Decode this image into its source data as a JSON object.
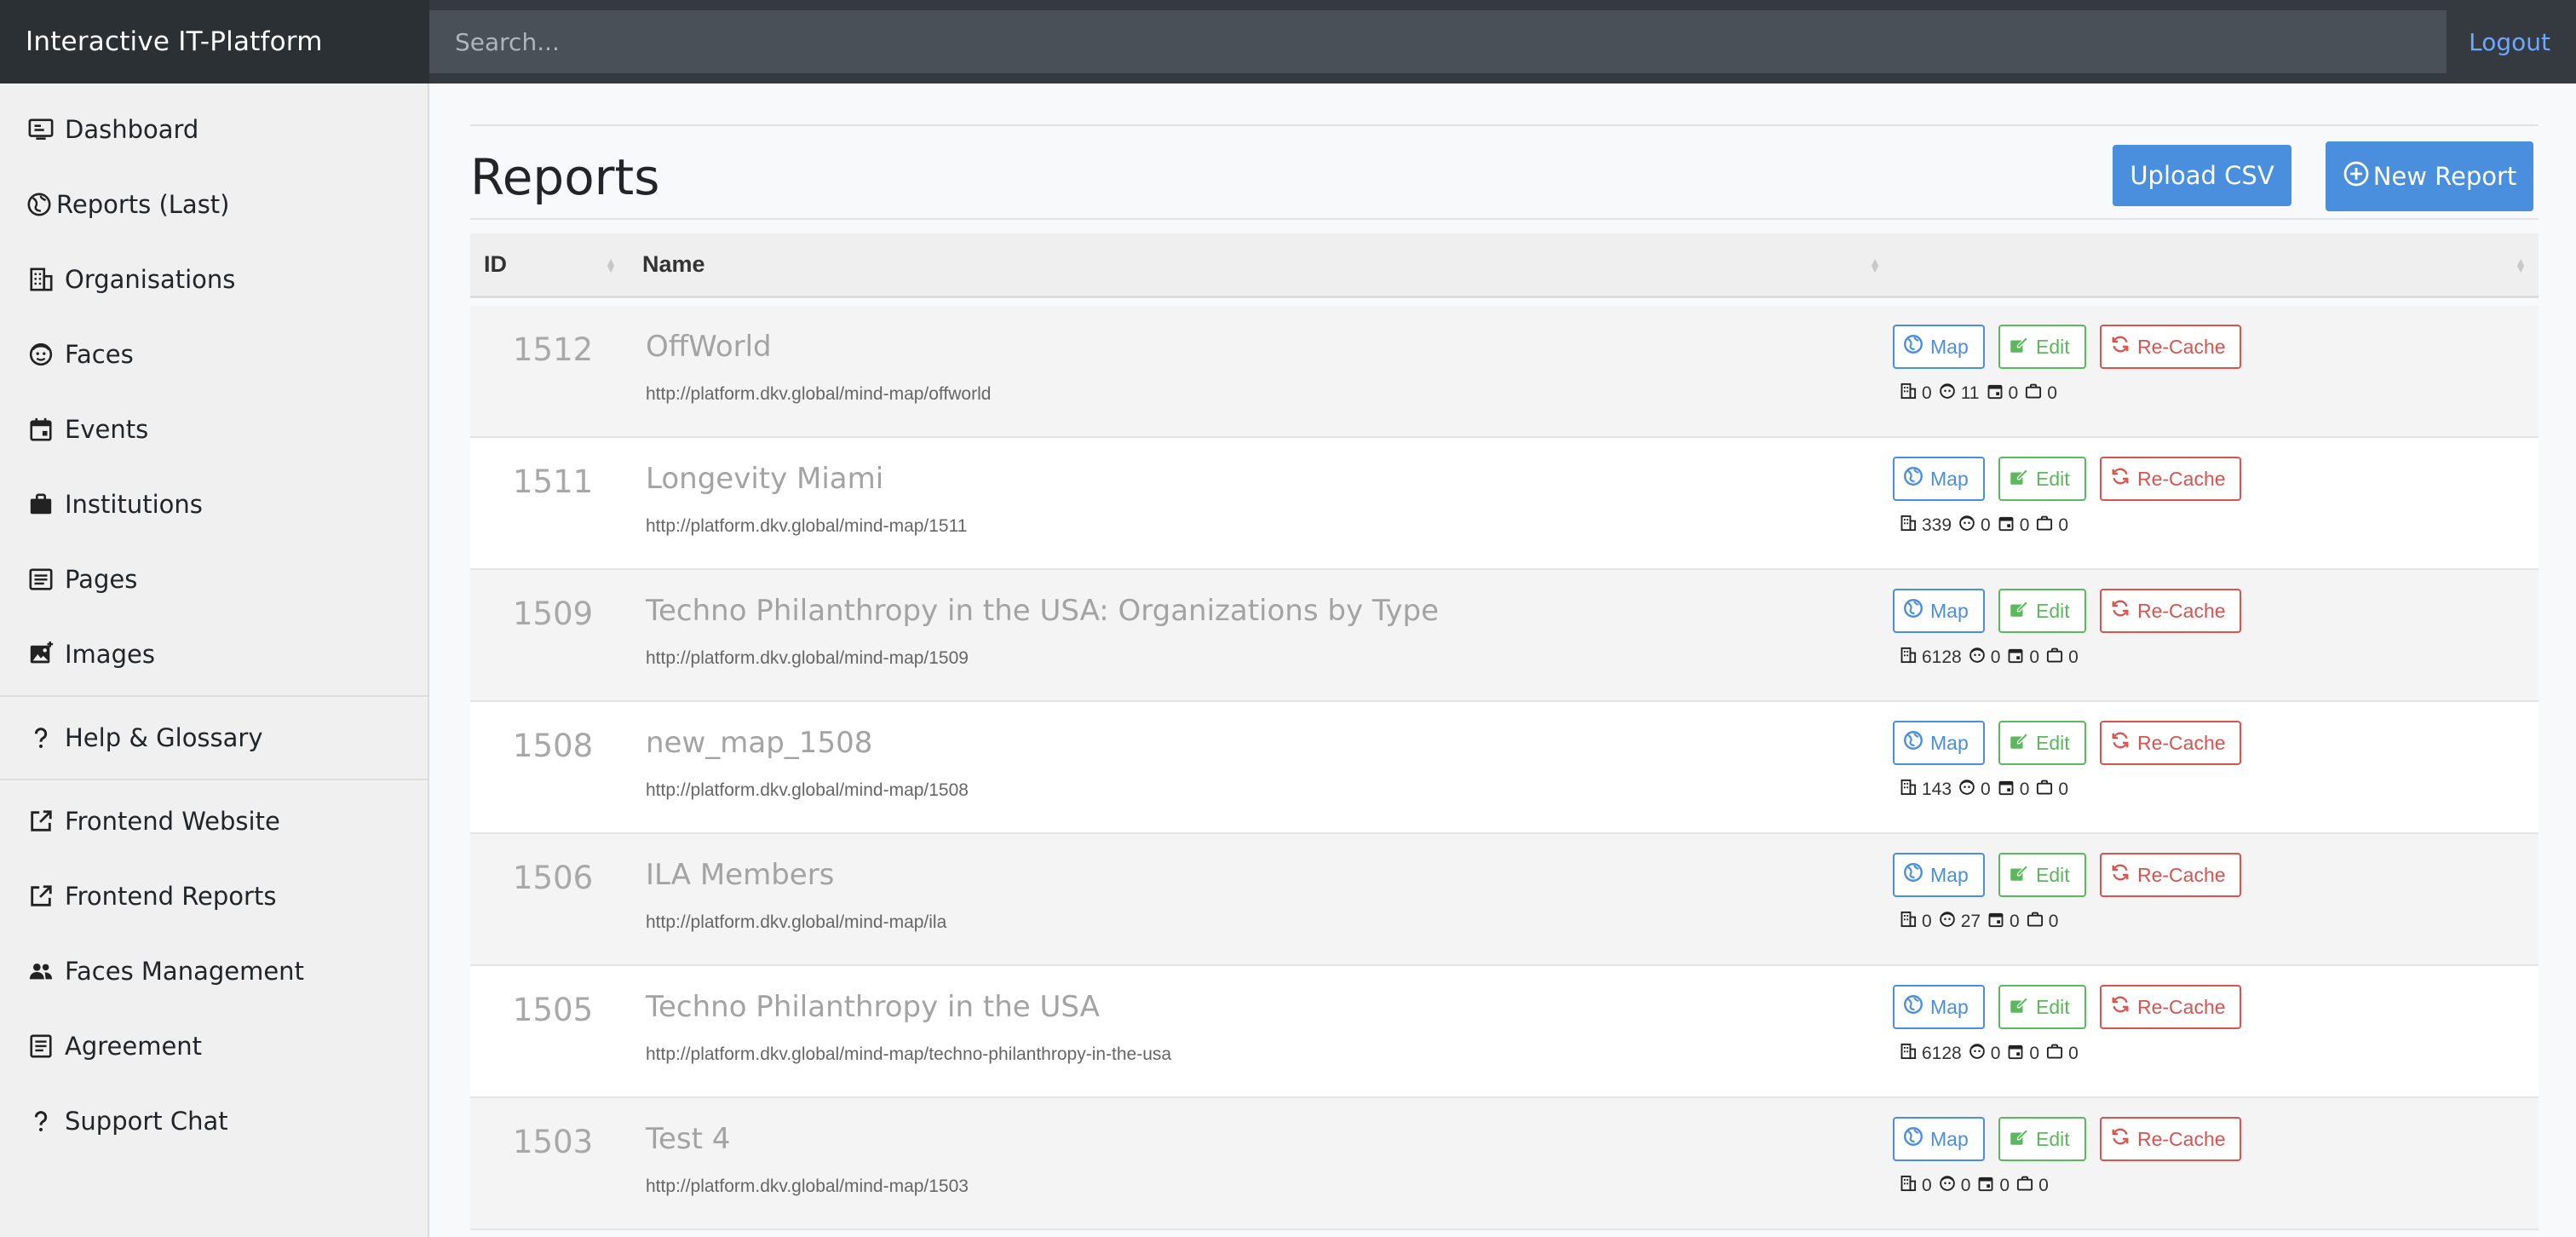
{
  "app": {
    "brand": "Interactive IT-Platform",
    "logout": "Logout"
  },
  "search": {
    "placeholder": "Search..."
  },
  "sidebar": {
    "items": [
      {
        "label": "Dashboard",
        "icon": "dashboard-icon"
      },
      {
        "label": "Reports (Last)",
        "icon": "globe-icon"
      },
      {
        "label": "Organisations",
        "icon": "building-icon"
      },
      {
        "label": "Faces",
        "icon": "face-icon"
      },
      {
        "label": "Events",
        "icon": "calendar-icon"
      },
      {
        "label": "Institutions",
        "icon": "briefcase-icon"
      },
      {
        "label": "Pages",
        "icon": "page-icon"
      },
      {
        "label": "Images",
        "icon": "image-icon"
      }
    ],
    "help": {
      "label": "Help & Glossary",
      "icon": "question-icon"
    },
    "external": [
      {
        "label": "Frontend Website",
        "icon": "external-link-icon"
      },
      {
        "label": "Frontend Reports",
        "icon": "external-link-icon"
      },
      {
        "label": "Faces Management",
        "icon": "people-icon"
      },
      {
        "label": "Agreement",
        "icon": "page-icon"
      },
      {
        "label": "Support Chat",
        "icon": "question-icon"
      }
    ]
  },
  "page": {
    "title": "Reports",
    "upload_label": "Upload CSV",
    "new_label": "New Report"
  },
  "table": {
    "headers": {
      "id": "ID",
      "name": "Name",
      "actions": ""
    },
    "action_labels": {
      "map": "Map",
      "edit": "Edit",
      "recache": "Re-Cache"
    },
    "rows": [
      {
        "id": "1512",
        "name": "OffWorld",
        "url": "http://platform.dkv.global/mind-map/offworld",
        "orgs": "0",
        "faces": "11",
        "events": "0",
        "institutions": "0"
      },
      {
        "id": "1511",
        "name": "Longevity Miami",
        "url": "http://platform.dkv.global/mind-map/1511",
        "orgs": "339",
        "faces": "0",
        "events": "0",
        "institutions": "0"
      },
      {
        "id": "1509",
        "name": "Techno Philanthropy in the USA: Organizations by Type",
        "url": "http://platform.dkv.global/mind-map/1509",
        "orgs": "6128",
        "faces": "0",
        "events": "0",
        "institutions": "0"
      },
      {
        "id": "1508",
        "name": "new_map_1508",
        "url": "http://platform.dkv.global/mind-map/1508",
        "orgs": "143",
        "faces": "0",
        "events": "0",
        "institutions": "0"
      },
      {
        "id": "1506",
        "name": "ILA Members",
        "url": "http://platform.dkv.global/mind-map/ila",
        "orgs": "0",
        "faces": "27",
        "events": "0",
        "institutions": "0"
      },
      {
        "id": "1505",
        "name": "Techno Philanthropy in the USA",
        "url": "http://platform.dkv.global/mind-map/techno-philanthropy-in-the-usa",
        "orgs": "6128",
        "faces": "0",
        "events": "0",
        "institutions": "0"
      },
      {
        "id": "1503",
        "name": "Test 4",
        "url": "http://platform.dkv.global/mind-map/1503",
        "orgs": "0",
        "faces": "0",
        "events": "0",
        "institutions": "0"
      }
    ]
  },
  "colors": {
    "navbar": "#343a40",
    "primary": "#4a8fdd",
    "success": "#5cb85c",
    "danger": "#d9534f"
  }
}
